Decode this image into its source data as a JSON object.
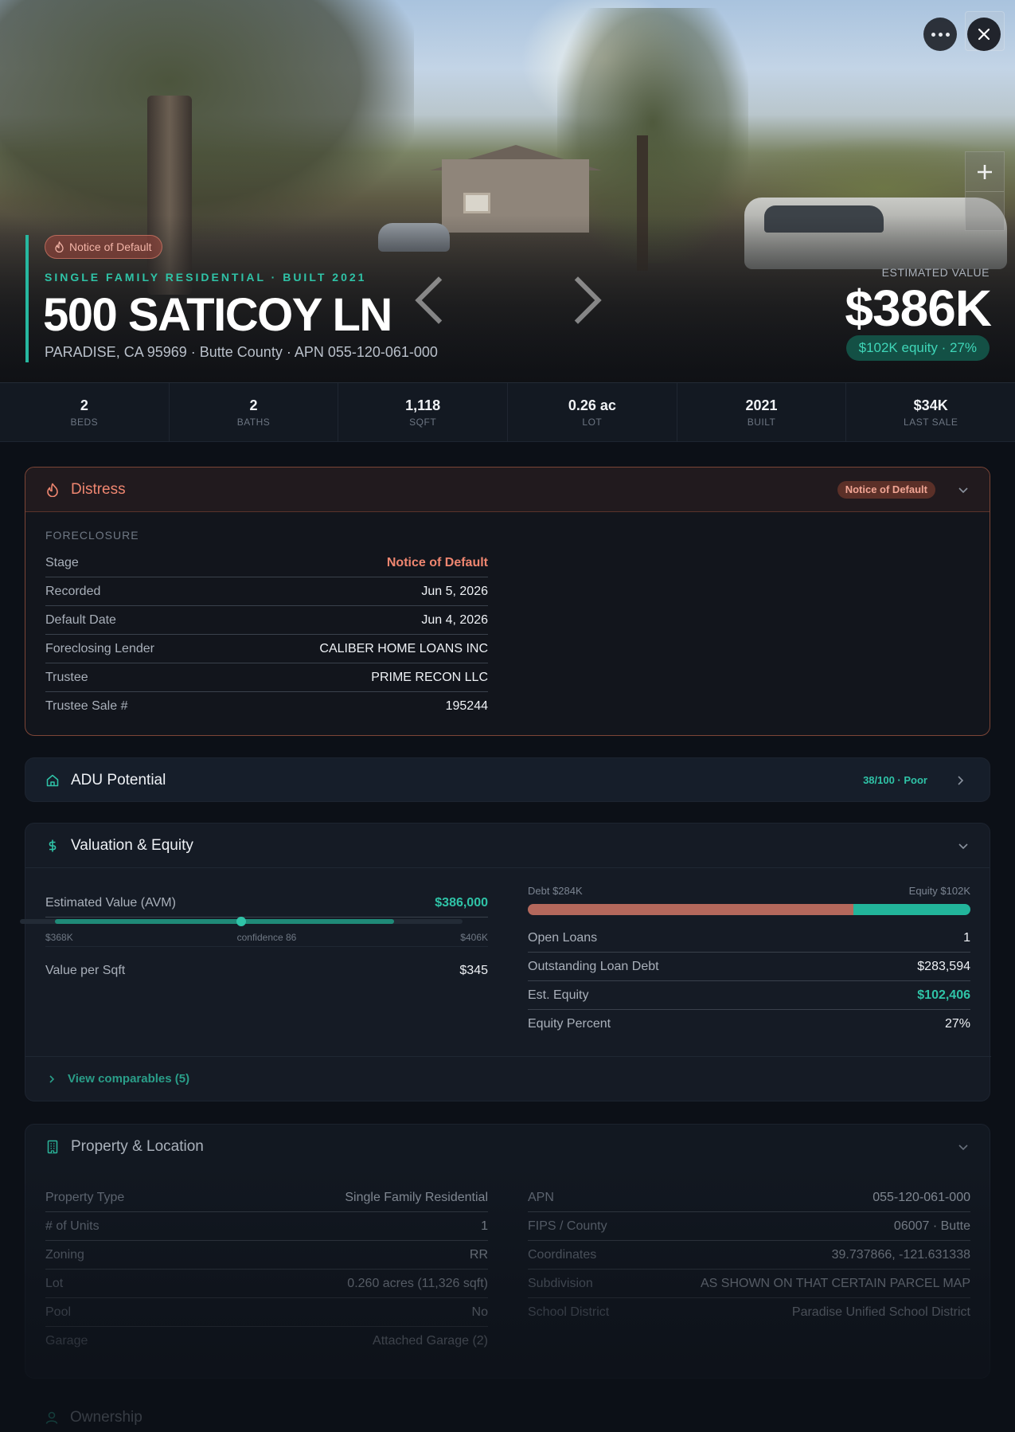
{
  "hero": {
    "status_badge": "Notice of Default",
    "eyebrow": "SINGLE FAMILY RESIDENTIAL · BUILT 2021",
    "address": "500 SATICOY LN",
    "location_line": "PARADISE, CA 95969 · Butte County · APN 055-120-061-000",
    "estimated_value_label": "ESTIMATED VALUE",
    "estimated_value": "$386K",
    "equity_badge": "$102K equity · 27%",
    "icons": {
      "more": "more-horizontal-icon",
      "close": "close-icon",
      "zoom": "plus-icon"
    }
  },
  "stats": [
    {
      "value": "2",
      "label": "BEDS"
    },
    {
      "value": "2",
      "label": "BATHS"
    },
    {
      "value": "1,118",
      "label": "SQFT"
    },
    {
      "value": "0.26 ac",
      "label": "LOT"
    },
    {
      "value": "2021",
      "label": "BUILT"
    },
    {
      "value": "$34K",
      "label": "LAST SALE"
    }
  ],
  "distress": {
    "title": "Distress",
    "badge": "Notice of Default",
    "section_label": "FORECLOSURE",
    "rows": [
      {
        "label": "Stage",
        "value": "Notice of Default"
      },
      {
        "label": "Recorded",
        "value": "Jun 5, 2026"
      },
      {
        "label": "Default Date",
        "value": "Jun 4, 2026"
      },
      {
        "label": "Foreclosing Lender",
        "value": "CALIBER HOME LOANS INC"
      },
      {
        "label": "Trustee",
        "value": "PRIME RECON LLC"
      },
      {
        "label": "Trustee Sale #",
        "value": "195244"
      }
    ]
  },
  "adu": {
    "title": "ADU Potential",
    "score": "38/100 · Poor"
  },
  "valuation": {
    "title": "Valuation & Equity",
    "avm_label": "Estimated Value (AVM)",
    "avm_value": "$386,000",
    "range_low": "$368K",
    "range_high": "$406K",
    "confidence_label": "confidence 86",
    "value_per_sqft_label": "Value per Sqft",
    "value_per_sqft": "$345",
    "debt_label": "Debt $284K",
    "equity_label": "Equity $102K",
    "debt_fraction": 0.735,
    "rows": [
      {
        "label": "Open Loans",
        "value": "1"
      },
      {
        "label": "Outstanding Loan Debt",
        "value": "$283,594"
      },
      {
        "label": "Est. Equity",
        "value": "$102,406"
      },
      {
        "label": "Equity Percent",
        "value": "27%"
      }
    ],
    "comparables_link": "View comparables (5)"
  },
  "property": {
    "title": "Property & Location",
    "left_rows": [
      {
        "label": "Property Type",
        "value": "Single Family Residential"
      },
      {
        "label": "# of Units",
        "value": "1"
      },
      {
        "label": "Zoning",
        "value": "RR"
      },
      {
        "label": "Lot",
        "value": "0.260 acres (11,326 sqft)"
      },
      {
        "label": "Pool",
        "value": "No"
      },
      {
        "label": "Garage",
        "value": "Attached Garage (2)"
      }
    ],
    "right_rows": [
      {
        "label": "APN",
        "value": "055-120-061-000"
      },
      {
        "label": "FIPS / County",
        "value": "06007 · Butte"
      },
      {
        "label": "Coordinates",
        "value": "39.737866, -121.631338"
      },
      {
        "label": "Subdivision",
        "value": "AS SHOWN ON THAT CERTAIN PARCEL MAP"
      },
      {
        "label": "School District",
        "value": "Paradise Unified School District"
      }
    ]
  },
  "ownership": {
    "title": "Ownership"
  },
  "colors": {
    "accent": "#2fc3a7",
    "distress": "#ef8670",
    "debt": "#b4685c",
    "equity": "#22b59b"
  }
}
